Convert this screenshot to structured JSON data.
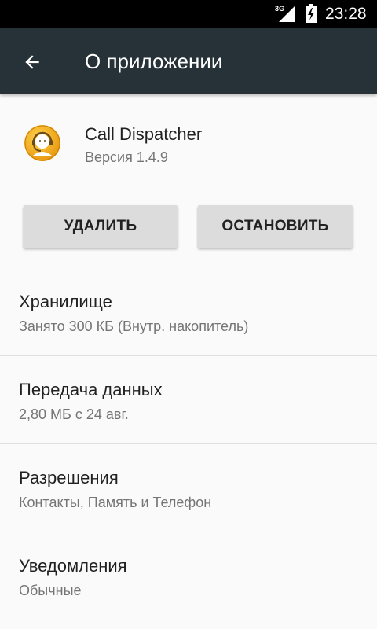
{
  "status_bar": {
    "network_label": "3G",
    "time": "23:28",
    "icons": [
      "signal-icon",
      "battery-charging-icon"
    ]
  },
  "app_bar": {
    "title": "О приложении",
    "back_icon": "arrow-back-icon",
    "background_color": "#263238"
  },
  "app": {
    "name": "Call Dispatcher",
    "version": "Версия 1.4.9",
    "icon": "call-dispatcher-app-icon",
    "icon_color": "#f0a818"
  },
  "actions": {
    "uninstall_label": "УДАЛИТЬ",
    "stop_label": "ОСТАНОВИТЬ"
  },
  "items": [
    {
      "title": "Хранилище",
      "subtitle": "Занято 300 КБ (Внутр. накопитель)"
    },
    {
      "title": "Передача данных",
      "subtitle": "2,80 МБ с 24 авг."
    },
    {
      "title": "Разрешения",
      "subtitle": "Контакты, Память и Телефон"
    },
    {
      "title": "Уведомления",
      "subtitle": "Обычные"
    }
  ]
}
